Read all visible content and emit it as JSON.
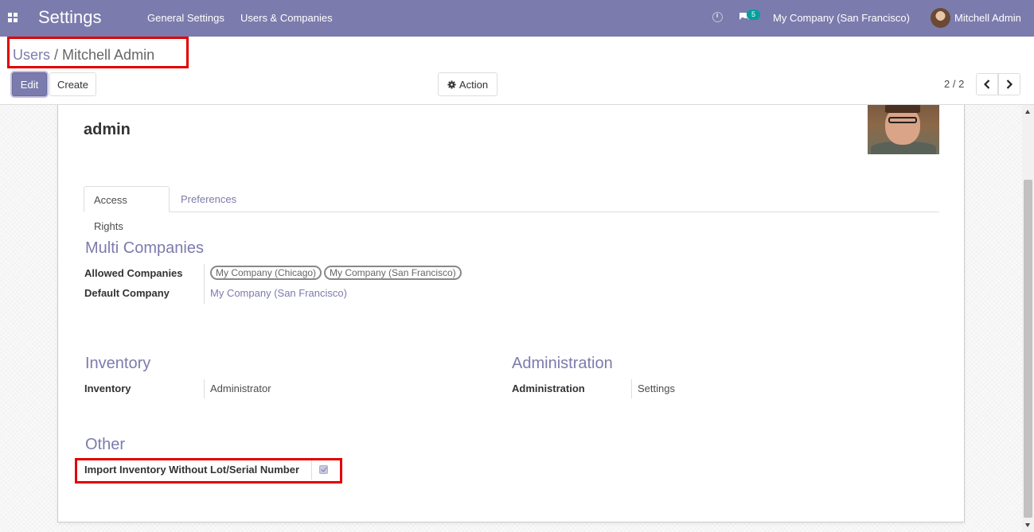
{
  "navbar": {
    "app_title": "Settings",
    "menu": [
      "General Settings",
      "Users & Companies"
    ],
    "messages_badge": "5",
    "company": "My Company (San Francisco)",
    "user": "Mitchell Admin",
    "color": "#7c7bad"
  },
  "breadcrumb": {
    "parent": "Users",
    "separator": "/",
    "current": "Mitchell Admin"
  },
  "buttons": {
    "edit": "Edit",
    "create": "Create",
    "action": "Action"
  },
  "pager": {
    "value": "2 / 2"
  },
  "record": {
    "name": "admin"
  },
  "tabs": [
    "Access Rights",
    "Preferences"
  ],
  "multi_companies": {
    "title": "Multi Companies",
    "allowed_label": "Allowed Companies",
    "allowed_tags": [
      "My Company (Chicago)",
      "My Company (San Francisco)"
    ],
    "default_label": "Default Company",
    "default_value": "My Company (San Francisco)"
  },
  "inventory": {
    "title": "Inventory",
    "label": "Inventory",
    "value": "Administrator"
  },
  "administration": {
    "title": "Administration",
    "label": "Administration",
    "value": "Settings"
  },
  "other": {
    "title": "Other",
    "import_label": "Import Inventory Without Lot/Serial Number",
    "import_checked": true
  },
  "icons": {
    "apps": "apps-grid-icon",
    "clock": "clock-icon",
    "chat": "chat-icon",
    "gear": "gear-icon",
    "prev": "chevron-left-icon",
    "next": "chevron-right-icon"
  },
  "highlight_color": "#e10000"
}
